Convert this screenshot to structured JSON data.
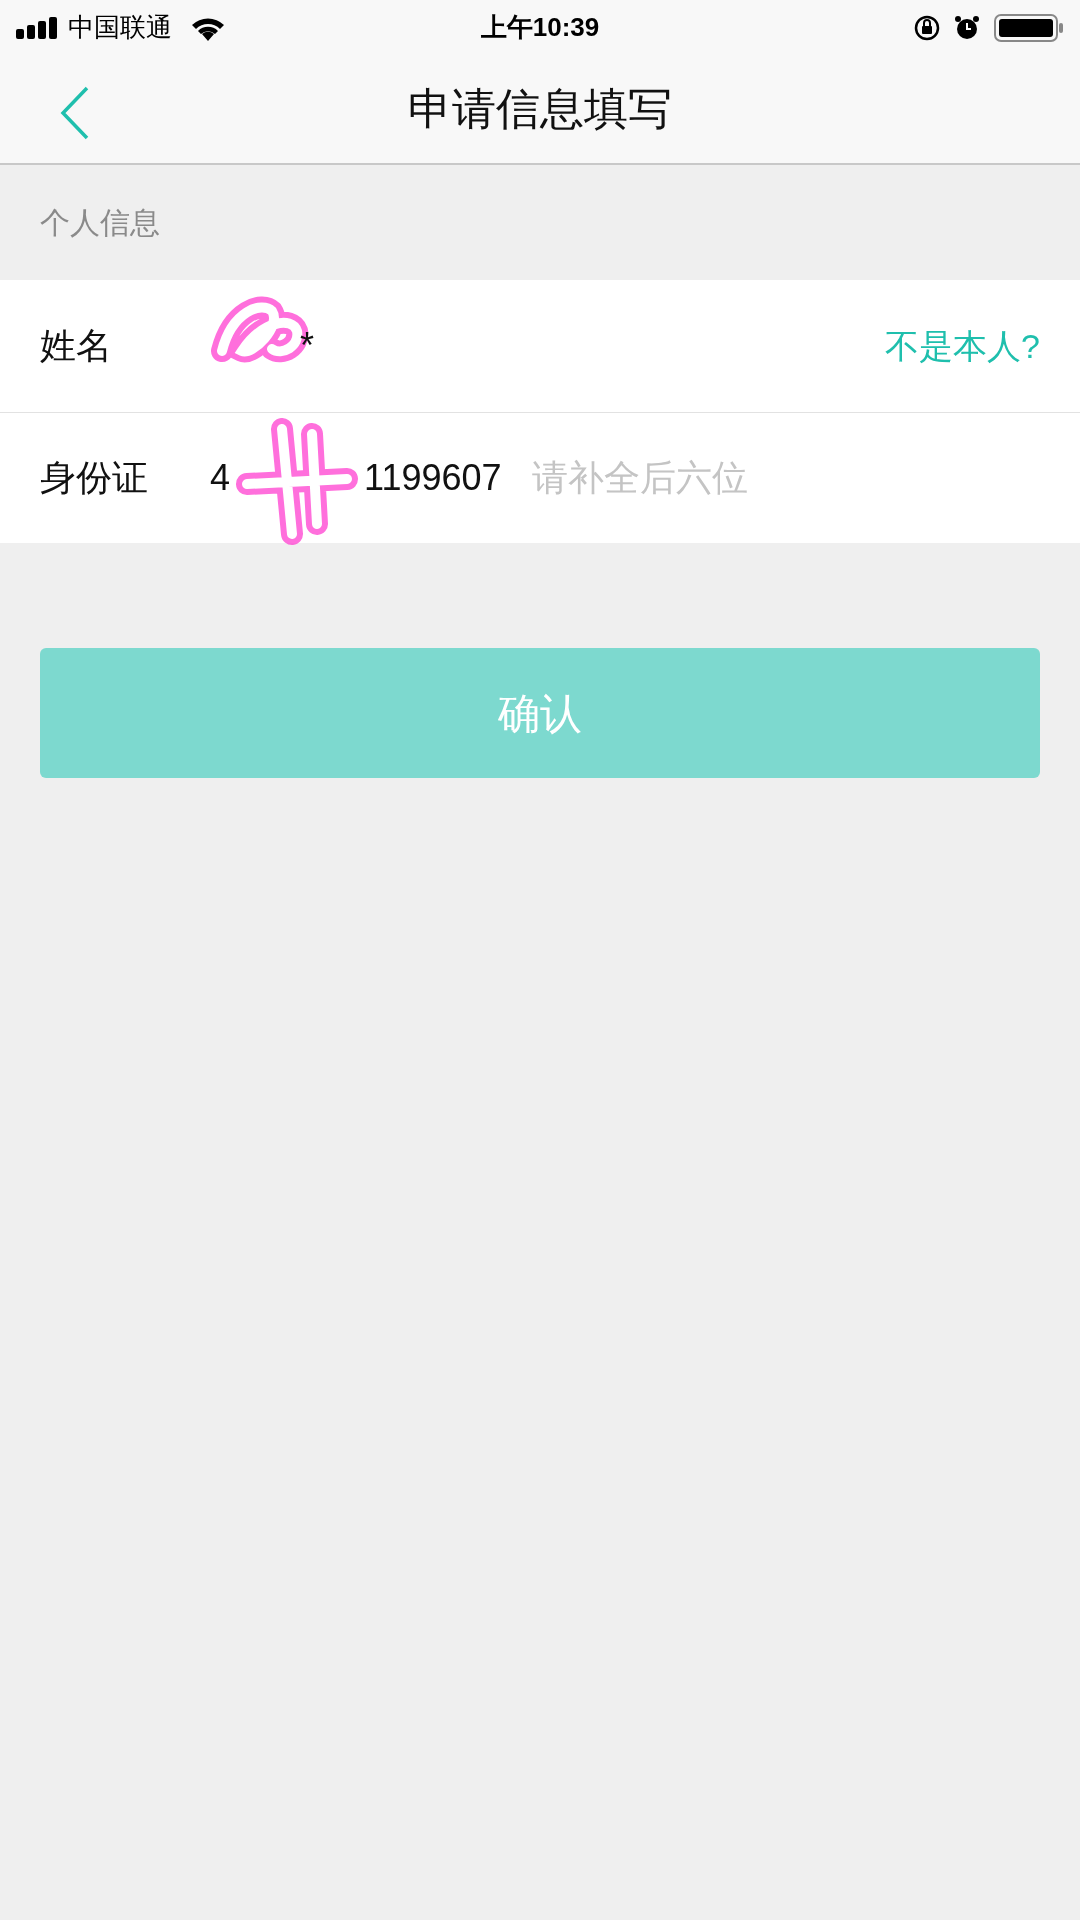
{
  "status_bar": {
    "carrier": "中国联通",
    "time": "上午10:39"
  },
  "nav": {
    "title": "申请信息填写"
  },
  "section": {
    "title": "个人信息"
  },
  "name_row": {
    "label": "姓名",
    "value": "*",
    "action": "不是本人?"
  },
  "id_row": {
    "label": "身份证",
    "value_start": "4",
    "value_end": "1199607",
    "placeholder": "请补全后六位"
  },
  "confirm_button": {
    "label": "确认",
    "disabled": true
  }
}
